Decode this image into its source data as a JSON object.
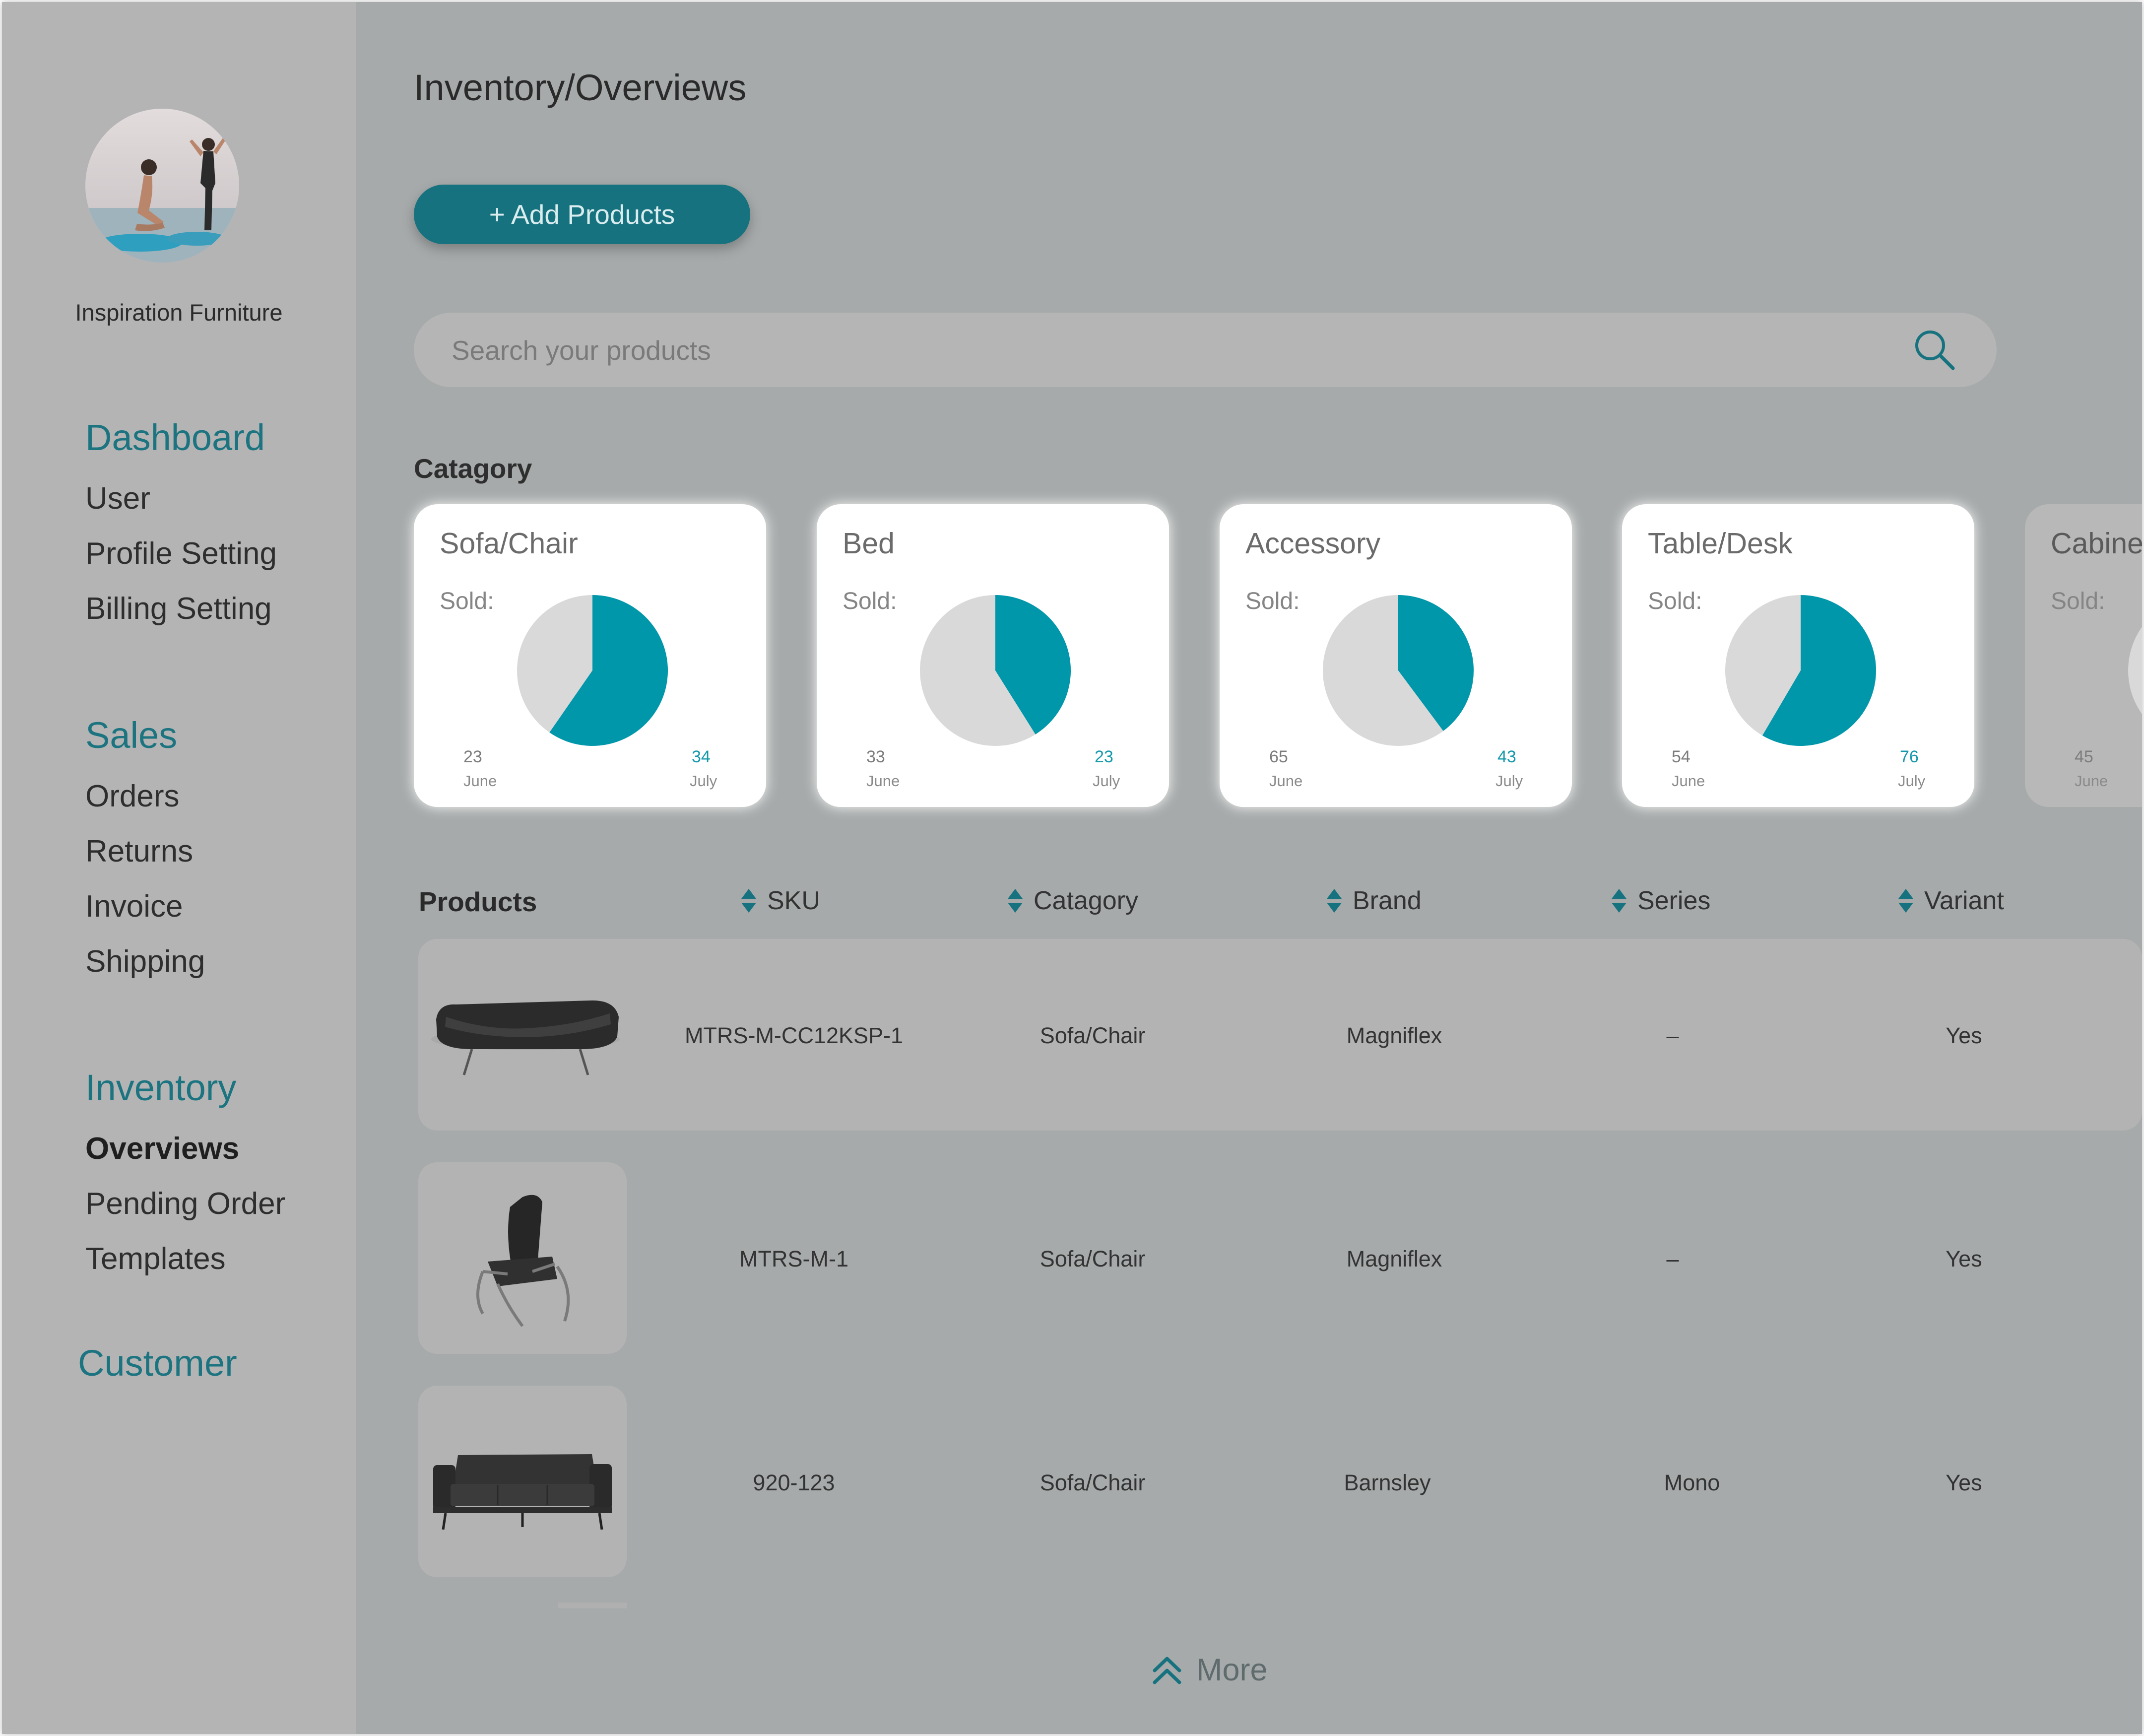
{
  "sidebar": {
    "brand_name": "Inspiration Furniture",
    "sections": [
      {
        "heading": "Dashboard",
        "items": [
          "User",
          "Profile Setting",
          "Billing Setting"
        ]
      },
      {
        "heading": "Sales",
        "items": [
          "Orders",
          "Returns",
          "Invoice",
          "Shipping"
        ]
      },
      {
        "heading": "Inventory",
        "items": [
          "Overviews",
          "Pending Order",
          "Templates"
        ]
      },
      {
        "heading": "Customer",
        "items": []
      }
    ],
    "active_item": "Overviews",
    "accent_color": "#1c7480"
  },
  "header": {
    "breadcrumb": "Inventory/Overviews",
    "add_button": "+ Add Products",
    "button_color": "#17727f"
  },
  "search": {
    "placeholder": "Search your products",
    "icon": "search-icon"
  },
  "category": {
    "title": "Catagory",
    "sold_label": "Sold:",
    "month_labels": [
      "June",
      "July"
    ],
    "cards": [
      {
        "name": "Sofa/Chair",
        "june": "23",
        "july": "34"
      },
      {
        "name": "Bed",
        "june": "33",
        "july": "23"
      },
      {
        "name": "Accessory",
        "june": "65",
        "july": "43"
      },
      {
        "name": "Table/Desk",
        "june": "54",
        "july": "76"
      },
      {
        "name": "Cabinet",
        "june": "45",
        "july": ""
      }
    ],
    "pie_colors": {
      "june": "#d9d9d9",
      "july": "#0197ab"
    }
  },
  "table": {
    "headers": [
      "Products",
      "SKU",
      "Catagory",
      "Brand",
      "Series",
      "Variant"
    ],
    "rows": [
      {
        "image": "sofa-image",
        "sku": "MTRS-M-CC12KSP-1",
        "category": "Sofa/Chair",
        "brand": "Magniflex",
        "series": "–",
        "variant": "Yes"
      },
      {
        "image": "recliner-chair-image",
        "sku": "MTRS-M-1",
        "category": "Sofa/Chair",
        "brand": "Magniflex",
        "series": "–",
        "variant": "Yes"
      },
      {
        "image": "couch-image",
        "sku": "920-123",
        "category": "Sofa/Chair",
        "brand": "Barnsley",
        "series": "Mono",
        "variant": "Yes"
      }
    ]
  },
  "footer": {
    "more_label": "More",
    "icon": "double-chevron-up-icon"
  }
}
